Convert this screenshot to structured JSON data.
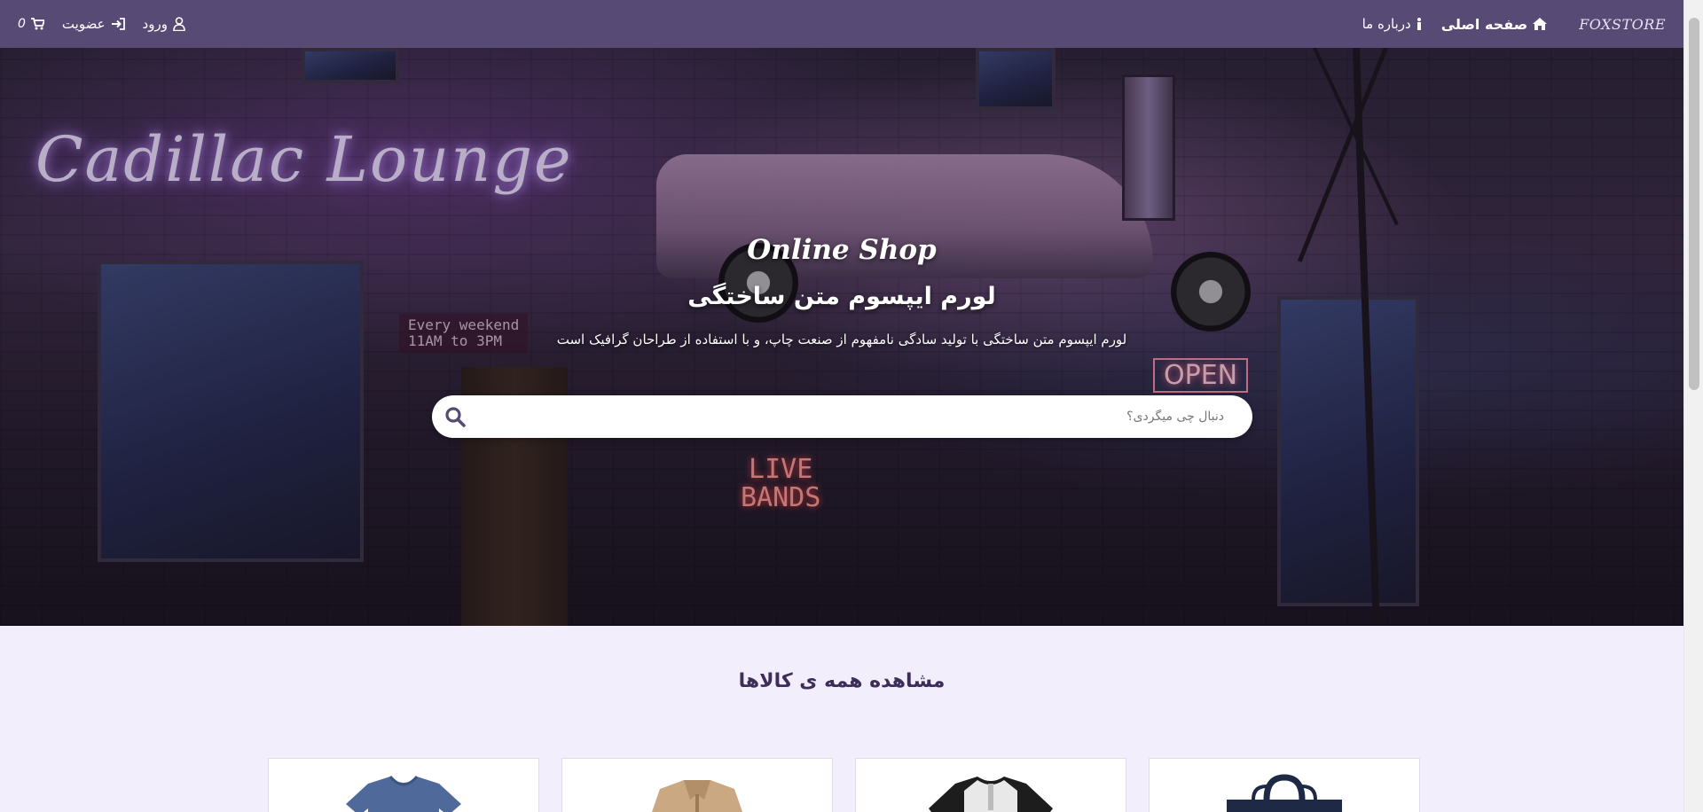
{
  "nav": {
    "brand": "FOXSTORE",
    "home": "صفحه اصلی",
    "about": "درباره ما",
    "cart_count": "0",
    "register": "عضویت",
    "login": "ورود"
  },
  "hero": {
    "title": "Online Shop",
    "subtitle": "لورم ایپسوم متن ساختگی",
    "description": "لورم ایپسوم متن ساختگی با تولید سادگی نامفهوم از صنعت چاپ، و با استفاده از طراحان گرافیک است",
    "search_placeholder": "دنبال چی میگردی؟",
    "scene_text": {
      "neon": "Cadillac Lounge",
      "weekend_line1": "Every weekend",
      "weekend_line2": "11AM to 3PM",
      "open": "OPEN",
      "live_bands_line1": "LIVE",
      "live_bands_line2": "BANDS"
    }
  },
  "products": {
    "title": "مشاهده همه ی کالاها",
    "items": [
      {
        "icon": "blue-tshirt-icon",
        "color": "#4f6a9a"
      },
      {
        "icon": "tan-jacket-icon",
        "color": "#c9a882"
      },
      {
        "icon": "raglan-shirt-icon",
        "color": "#1d1d1d"
      },
      {
        "icon": "navy-bag-icon",
        "color": "#1e2a45"
      }
    ]
  },
  "colors": {
    "navbar": "#574a74",
    "page_bg": "#f3eefb",
    "section_title": "#3c2e57"
  }
}
